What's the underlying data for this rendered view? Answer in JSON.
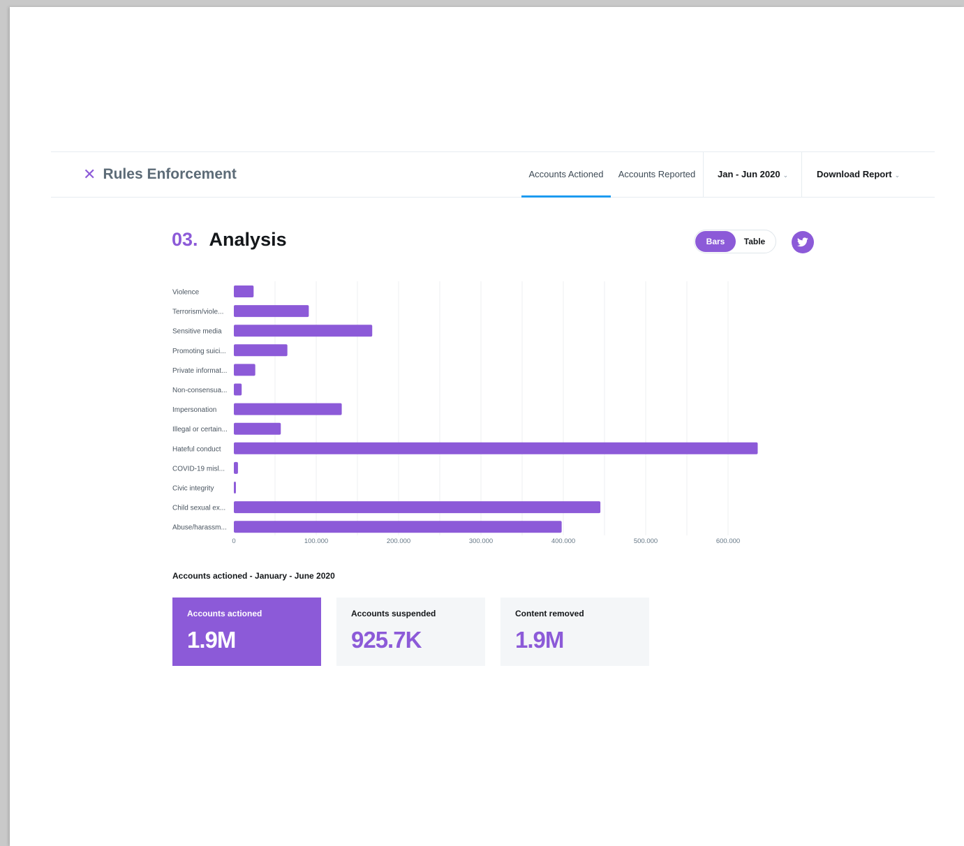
{
  "header": {
    "title": "Rules Enforcement",
    "tabs": [
      {
        "label": "Accounts Actioned",
        "active": true
      },
      {
        "label": "Accounts Reported",
        "active": false
      }
    ],
    "period_label": "Jan - Jun 2020",
    "download_label": "Download Report"
  },
  "section": {
    "number": "03.",
    "title": "Analysis",
    "view_toggle": {
      "options": [
        "Bars",
        "Table"
      ],
      "selected": "Bars"
    }
  },
  "colors": {
    "accent": "#8c5ad8",
    "tab_underline": "#1d9bf0"
  },
  "chart_data": {
    "type": "bar",
    "orientation": "horizontal",
    "categories": [
      "Violence",
      "Terrorism/viole...",
      "Sensitive media",
      "Promoting suici...",
      "Private informat...",
      "Non-consensua...",
      "Impersonation",
      "Illegal or certain...",
      "Hateful conduct",
      "COVID-19 misl...",
      "Civic integrity",
      "Child sexual ex...",
      "Abuse/harassm..."
    ],
    "values": [
      24000,
      91000,
      168000,
      65000,
      26000,
      9500,
      131000,
      57000,
      636000,
      5000,
      2500,
      445000,
      398000
    ],
    "xlim": [
      0,
      600000
    ],
    "xticks": [
      "0",
      "100.000",
      "200.000",
      "300.000",
      "400.000",
      "500.000",
      "600.000"
    ],
    "grid": true,
    "color": "#8c5ad8"
  },
  "stats": {
    "label": "Accounts actioned - January - June 2020",
    "cards": [
      {
        "label": "Accounts actioned",
        "value": "1.9M",
        "active": true
      },
      {
        "label": "Accounts suspended",
        "value": "925.7K",
        "active": false
      },
      {
        "label": "Content removed",
        "value": "1.9M",
        "active": false
      }
    ]
  }
}
